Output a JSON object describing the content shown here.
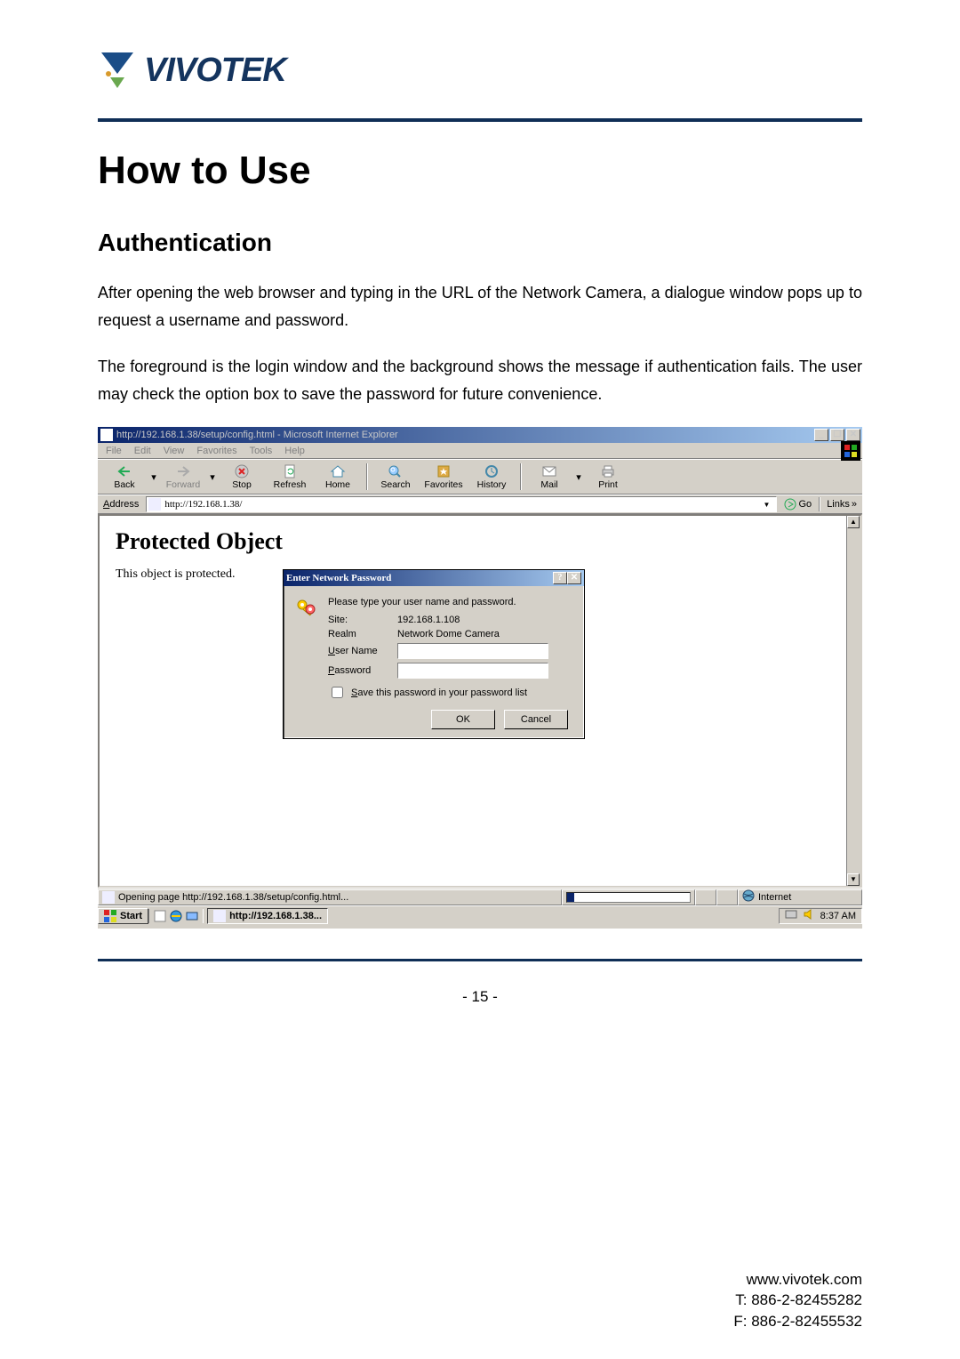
{
  "logo_text": "VIVOTEK",
  "doc": {
    "title": "How to Use",
    "subtitle": "Authentication",
    "p1": "After opening the web browser and typing in the URL of the Network Camera, a dialogue window pops up to request a username and password.",
    "p2": "The foreground is the login window and the background shows the message if authentication fails. The user may check the option box to save the password for future convenience."
  },
  "ie": {
    "title": "http://192.168.1.38/setup/config.html - Microsoft Internet Explorer",
    "min": "_",
    "max": "❐",
    "close": "✕",
    "menu": {
      "file": "File",
      "edit": "Edit",
      "view": "View",
      "favorites": "Favorites",
      "tools": "Tools",
      "help": "Help"
    },
    "tb": {
      "back": "Back",
      "forward": "Forward",
      "stop": "Stop",
      "refresh": "Refresh",
      "home": "Home",
      "search": "Search",
      "favorites": "Favorites",
      "history": "History",
      "mail": "Mail",
      "print": "Print"
    },
    "addr_label": "Address",
    "addr_value": "http://192.168.1.38/",
    "go": "Go",
    "links": "Links",
    "content": {
      "h1": "Protected Object",
      "text": "This object is protected."
    },
    "dialog": {
      "title": "Enter Network Password",
      "help": "?",
      "close": "✕",
      "prompt": "Please type your user name and password.",
      "site_label": "Site:",
      "site_value": "192.168.1.108",
      "realm_label": "Realm",
      "realm_value": "Network Dome Camera",
      "user_label": "User Name",
      "pass_label": "Password",
      "save_label": "Save this password in your password list",
      "ok": "OK",
      "cancel": "Cancel"
    },
    "status_text": "Opening page http://192.168.1.38/setup/config.html...",
    "status_zone": "Internet"
  },
  "taskbar": {
    "start": "Start",
    "task": "http://192.168.1.38...",
    "time": "8:37 AM"
  },
  "page_num": "- 15 -",
  "footer": {
    "url": "www.vivotek.com",
    "tel": "T: 886-2-82455282",
    "fax": "F: 886-2-82455532"
  }
}
